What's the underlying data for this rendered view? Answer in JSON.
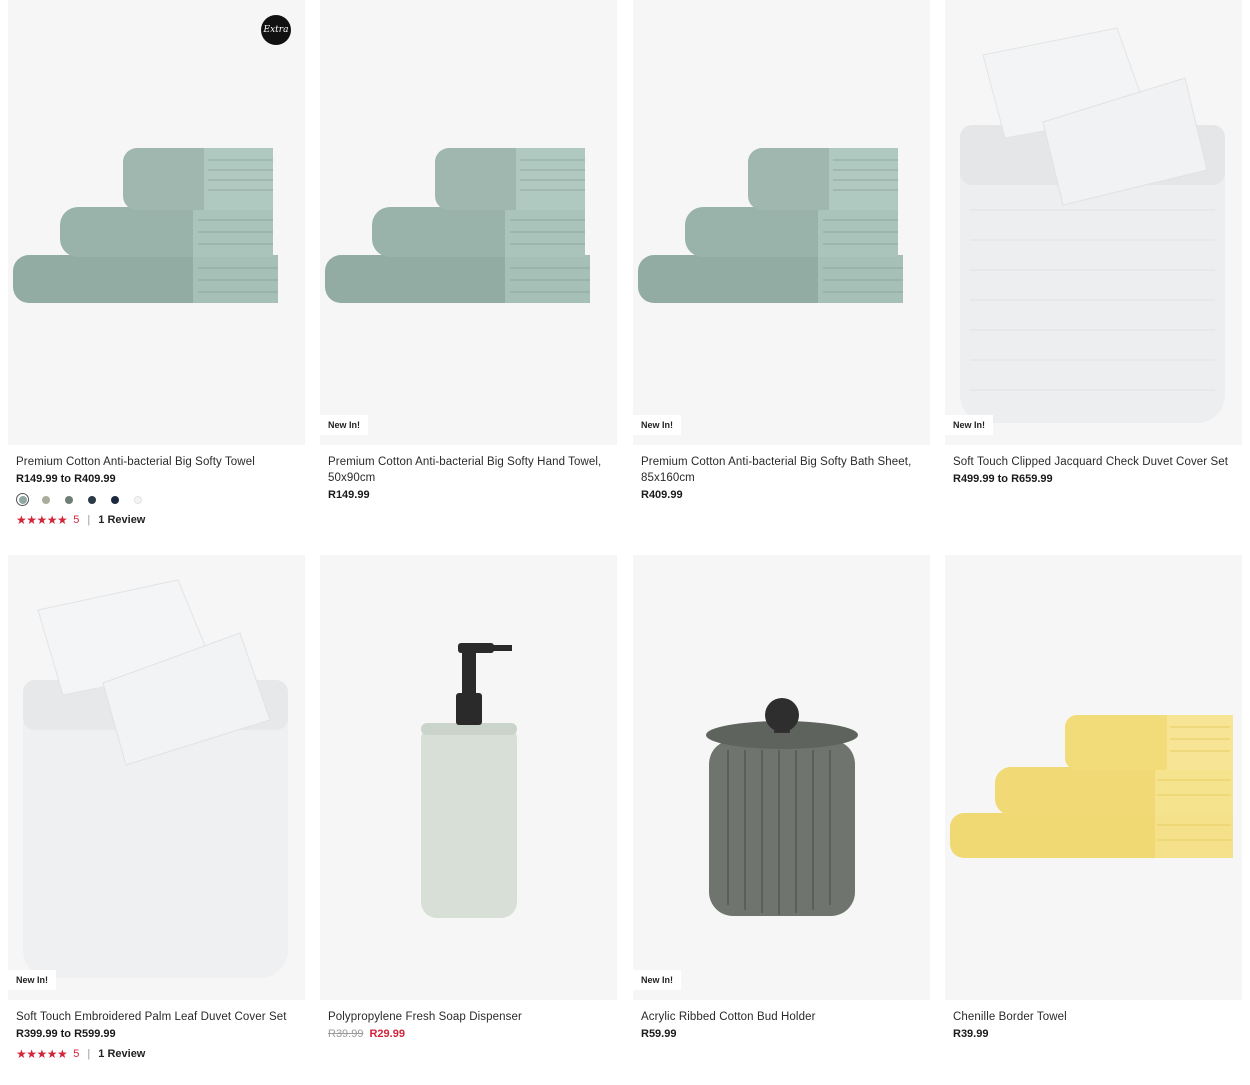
{
  "products": [
    {
      "title": "Premium Cotton Anti-bacterial Big Softy Towel",
      "price": "R149.99 to R409.99",
      "badge_extra": "Extra",
      "swatches": [
        "#8fa9a2",
        "#a8ad9c",
        "#6f7f78",
        "#2c3a46",
        "#1a2940",
        "#f4f4f4"
      ],
      "rating": "5",
      "rating_sep": "|",
      "reviews": "1 Review",
      "stars": "★★★★★"
    },
    {
      "title": "Premium Cotton Anti-bacterial Big Softy Hand Towel, 50x90cm",
      "price": "R149.99",
      "badge": "New In!"
    },
    {
      "title": "Premium Cotton Anti-bacterial Big Softy Bath Sheet, 85x160cm",
      "price": "R409.99",
      "badge": "New In!"
    },
    {
      "title": "Soft Touch Clipped Jacquard Check Duvet Cover Set",
      "price": "R499.99 to R659.99",
      "badge": "New In!"
    },
    {
      "title": "Soft Touch Embroidered Palm Leaf Duvet Cover Set",
      "price": "R399.99 to R599.99",
      "badge": "New In!",
      "rating": "5",
      "rating_sep": "|",
      "reviews": "1 Review",
      "stars": "★★★★★"
    },
    {
      "title": "Polypropylene Fresh Soap Dispenser",
      "price_old": "R39.99",
      "price_sale": "R29.99"
    },
    {
      "title": "Acrylic Ribbed Cotton Bud Holder",
      "price": "R59.99",
      "badge": "New In!"
    },
    {
      "title": "Chenille Border Towel",
      "price": "R39.99"
    }
  ],
  "colors": {
    "towel_sage": "#9fb7ae",
    "towel_yellow": "#f2dc7a",
    "sale": "#d0253a"
  }
}
